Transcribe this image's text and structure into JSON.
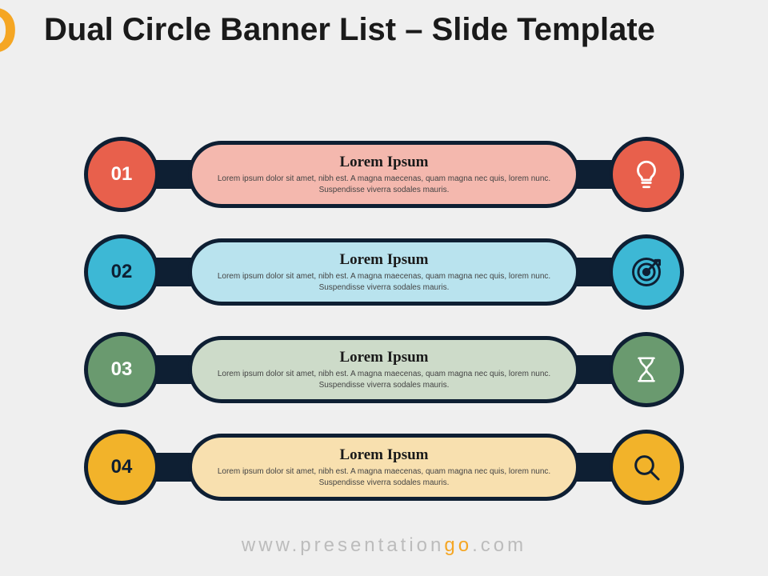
{
  "title": "Dual Circle Banner List – Slide Template",
  "logo_fragment": "O",
  "rows": [
    {
      "num": "01",
      "heading": "Lorem Ipsum",
      "body": "Lorem ipsum dolor sit amet, nibh est. A magna maecenas, quam magna nec quis, lorem nunc. Suspendisse viverra sodales mauris.",
      "icon": "lightbulb-icon",
      "color": "#e8604c",
      "pill_color": "#f4b8ae"
    },
    {
      "num": "02",
      "heading": "Lorem Ipsum",
      "body": "Lorem ipsum dolor sit amet, nibh est. A magna maecenas, quam magna nec quis, lorem nunc. Suspendisse viverra sodales mauris.",
      "icon": "target-icon",
      "color": "#3db8d5",
      "pill_color": "#b9e3ee"
    },
    {
      "num": "03",
      "heading": "Lorem Ipsum",
      "body": "Lorem ipsum dolor sit amet, nibh est. A magna maecenas, quam magna nec quis, lorem nunc. Suspendisse viverra sodales mauris.",
      "icon": "hourglass-icon",
      "color": "#6a9a6f",
      "pill_color": "#cddbc9"
    },
    {
      "num": "04",
      "heading": "Lorem Ipsum",
      "body": "Lorem ipsum dolor sit amet, nibh est. A magna maecenas, quam magna nec quis, lorem nunc. Suspendisse viverra sodales mauris.",
      "icon": "magnifier-icon",
      "color": "#f2b32a",
      "pill_color": "#f8e0af"
    }
  ],
  "footer": {
    "pre": "www.",
    "mid": "presentation",
    "accent": "go",
    "post": ".com"
  }
}
